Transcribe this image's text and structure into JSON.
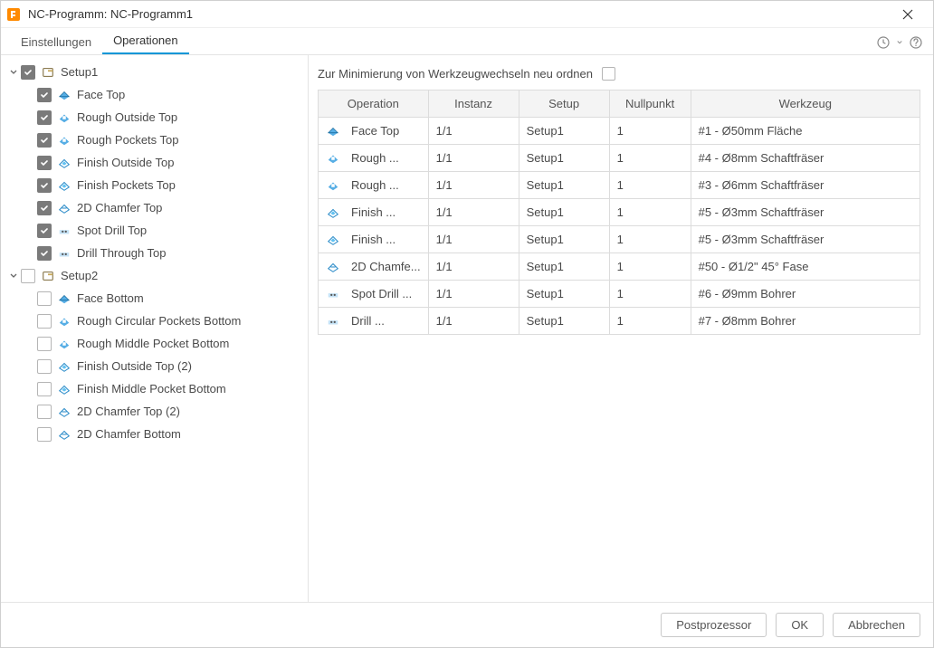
{
  "window": {
    "title": "NC-Programm: NC-Programm1"
  },
  "tabs": {
    "settings": "Einstellungen",
    "operations": "Operationen"
  },
  "reorder": {
    "label": "Zur Minimierung von Werkzeugwechseln neu ordnen"
  },
  "tree": {
    "setups": [
      {
        "name": "Setup1",
        "checked": true,
        "children": [
          {
            "name": "Face Top",
            "checked": true,
            "icon": "face"
          },
          {
            "name": "Rough Outside Top",
            "checked": true,
            "icon": "rough"
          },
          {
            "name": "Rough Pockets Top",
            "checked": true,
            "icon": "rough"
          },
          {
            "name": "Finish Outside Top",
            "checked": true,
            "icon": "finish"
          },
          {
            "name": "Finish Pockets Top",
            "checked": true,
            "icon": "finish"
          },
          {
            "name": "2D Chamfer Top",
            "checked": true,
            "icon": "chamfer"
          },
          {
            "name": "Spot Drill Top",
            "checked": true,
            "icon": "drill"
          },
          {
            "name": "Drill Through Top",
            "checked": true,
            "icon": "drill"
          }
        ]
      },
      {
        "name": "Setup2",
        "checked": false,
        "children": [
          {
            "name": "Face Bottom",
            "checked": false,
            "icon": "face"
          },
          {
            "name": "Rough Circular Pockets Bottom",
            "checked": false,
            "icon": "rough"
          },
          {
            "name": "Rough Middle Pocket Bottom",
            "checked": false,
            "icon": "rough"
          },
          {
            "name": "Finish Outside Top (2)",
            "checked": false,
            "icon": "finish"
          },
          {
            "name": "Finish Middle Pocket Bottom",
            "checked": false,
            "icon": "finish"
          },
          {
            "name": "2D Chamfer Top (2)",
            "checked": false,
            "icon": "chamfer"
          },
          {
            "name": "2D Chamfer Bottom",
            "checked": false,
            "icon": "chamfer"
          }
        ]
      }
    ]
  },
  "table": {
    "headers": {
      "operation": "Operation",
      "instance": "Instanz",
      "setup": "Setup",
      "wcs": "Nullpunkt",
      "tool": "Werkzeug"
    },
    "rows": [
      {
        "op": "Face Top",
        "icon": "face",
        "inst": "1/1",
        "setup": "Setup1",
        "wcs": "1",
        "tool": "#1 - Ø50mm Fläche"
      },
      {
        "op": "Rough ...",
        "icon": "rough",
        "inst": "1/1",
        "setup": "Setup1",
        "wcs": "1",
        "tool": "#4 - Ø8mm Schaftfräser"
      },
      {
        "op": "Rough ...",
        "icon": "rough",
        "inst": "1/1",
        "setup": "Setup1",
        "wcs": "1",
        "tool": "#3 - Ø6mm Schaftfräser"
      },
      {
        "op": "Finish ...",
        "icon": "finish",
        "inst": "1/1",
        "setup": "Setup1",
        "wcs": "1",
        "tool": "#5 - Ø3mm Schaftfräser"
      },
      {
        "op": "Finish ...",
        "icon": "finish",
        "inst": "1/1",
        "setup": "Setup1",
        "wcs": "1",
        "tool": "#5 - Ø3mm Schaftfräser"
      },
      {
        "op": "2D Chamfe...",
        "icon": "chamfer",
        "inst": "1/1",
        "setup": "Setup1",
        "wcs": "1",
        "tool": "#50 - Ø1/2\" 45° Fase"
      },
      {
        "op": "Spot Drill ...",
        "icon": "drill",
        "inst": "1/1",
        "setup": "Setup1",
        "wcs": "1",
        "tool": "#6 - Ø9mm Bohrer"
      },
      {
        "op": "Drill ...",
        "icon": "drill",
        "inst": "1/1",
        "setup": "Setup1",
        "wcs": "1",
        "tool": "#7 - Ø8mm Bohrer"
      }
    ]
  },
  "footer": {
    "post": "Postprozessor",
    "ok": "OK",
    "cancel": "Abbrechen"
  }
}
